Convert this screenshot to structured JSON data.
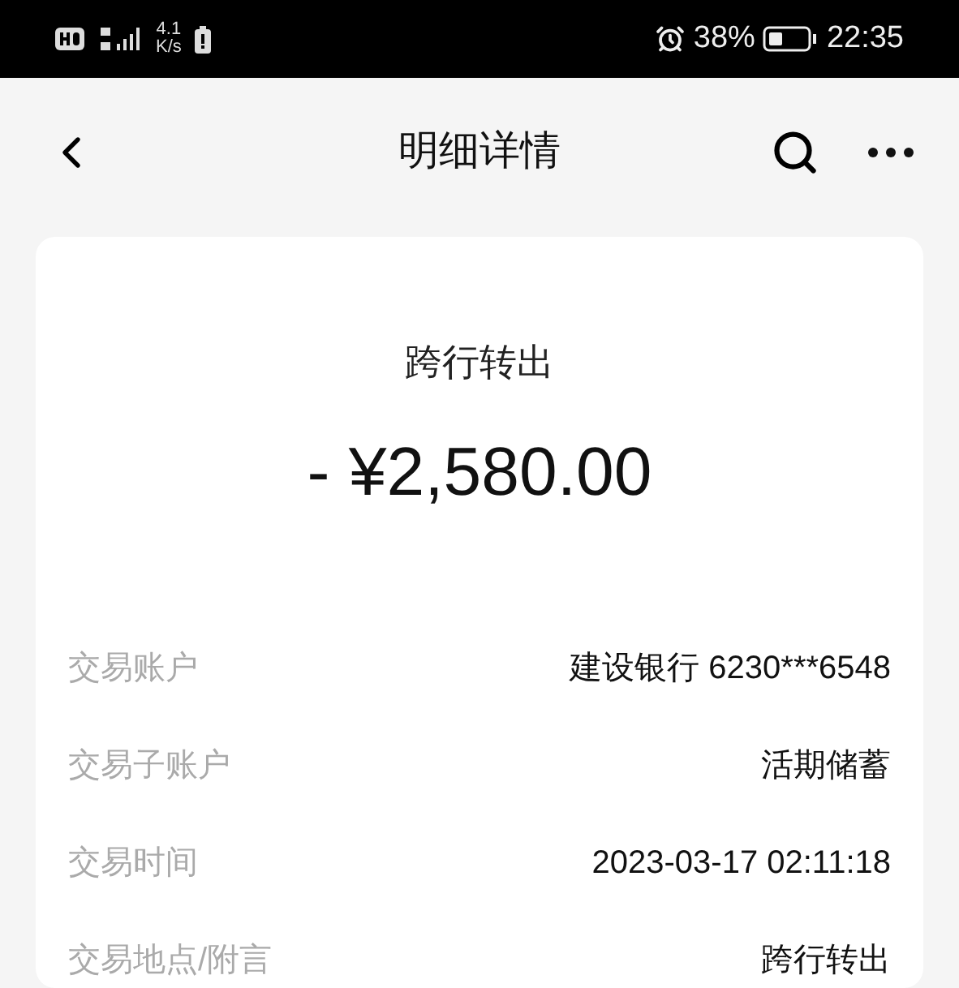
{
  "status_bar": {
    "speed_value": "4.1",
    "speed_unit": "K/s",
    "battery_percent": "38%",
    "time": "22:35"
  },
  "header": {
    "title": "明细详情"
  },
  "summary": {
    "type": "跨行转出",
    "amount": "- ¥2,580.00"
  },
  "details": [
    {
      "label": "交易账户",
      "value": "建设银行 6230***6548"
    },
    {
      "label": "交易子账户",
      "value": "活期储蓄"
    },
    {
      "label": "交易时间",
      "value": "2023-03-17 02:11:18"
    },
    {
      "label": "交易地点/附言",
      "value": "跨行转出"
    }
  ]
}
